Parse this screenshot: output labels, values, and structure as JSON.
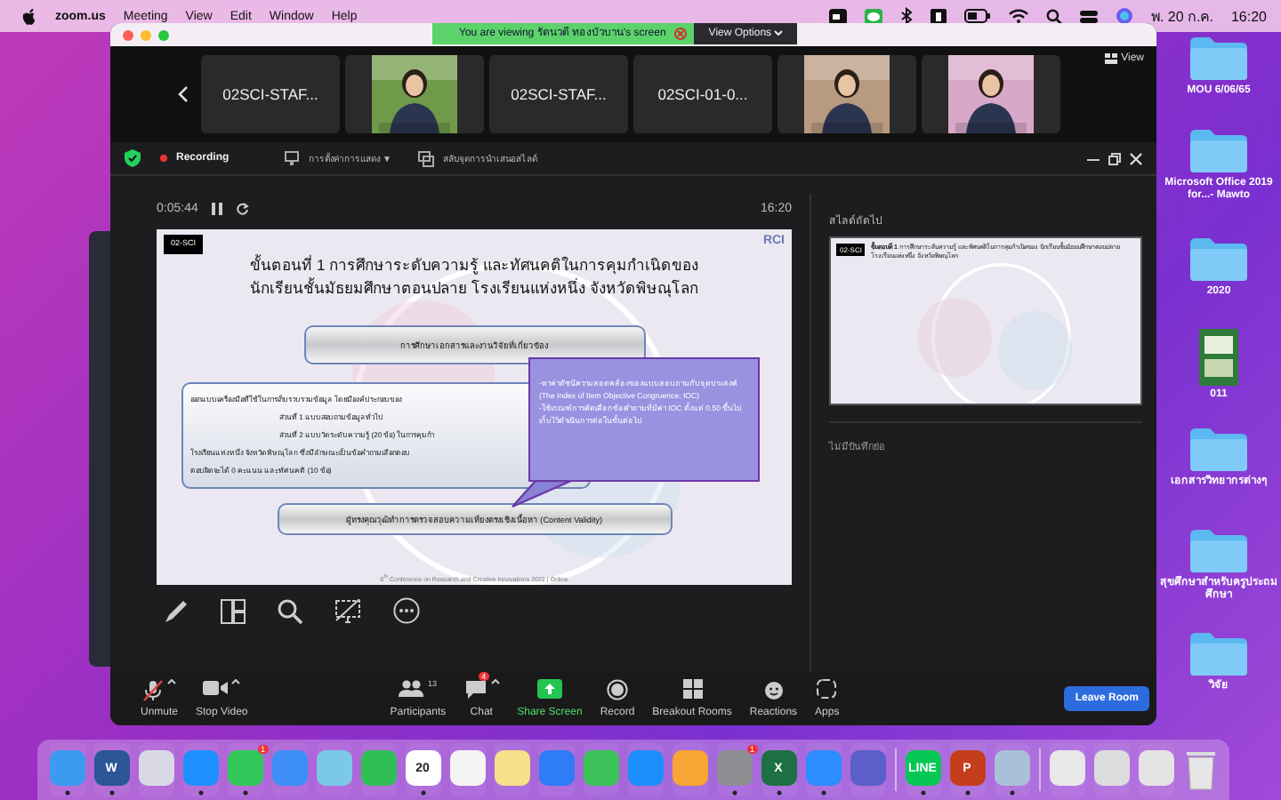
{
  "menu_bar": {
    "app": "zoom.us",
    "menus": [
      "Meeting",
      "View",
      "Edit",
      "Window",
      "Help"
    ],
    "date": "พ. 20 ก.ค.",
    "time": "16:20"
  },
  "banner": {
    "text": "You are viewing รัตนวดี ทองบัวบาน's screen",
    "options": "View Options"
  },
  "gallery": {
    "view": "View",
    "tiles": [
      {
        "kind": "name",
        "label": "02SCI-STAF..."
      },
      {
        "kind": "picture",
        "color": "#6f9a4a"
      },
      {
        "kind": "name",
        "label": "02SCI-STAF..."
      },
      {
        "kind": "name",
        "label": "02SCI-01-0..."
      },
      {
        "kind": "picture",
        "color": "#b89a80"
      },
      {
        "kind": "picture",
        "color": "#d8a8c8"
      }
    ]
  },
  "share_toolbar": {
    "recording": "Recording",
    "display_settings": "การตั้งค่าการแสดง ▼",
    "swap": "สลับจุดการนำเสนอสไลด์"
  },
  "presenter": {
    "elapsed": "0:05:44",
    "clock": "16:20",
    "slide": {
      "badge": "02-SCI",
      "logo": "RCI",
      "title": [
        "ขั้นตอนที่ 1 การศึกษาระดับความรู้ และทัศนคติในการคุมกำเนิดของ",
        "นักเรียนชั้นมัธยมศึกษาตอนปลาย โรงเรียนแห่งหนึ่ง จังหวัดพิษณุโลก"
      ],
      "box_1": "การศึกษาเอกสารและงานวิจัยที่เกี่ยวข้อง",
      "box_2": [
        "ออกแบบเครื่องมือที่ใช้ในการเก็บรวบรวมข้อมูล โดยมีองค์ประกอบของ",
        "ส่วนที่ 1 แบบสอบถามข้อมูลทั่วไป",
        "ส่วนที่ 2 แบบวัดระดับความรู้ (20 ข้อ) ในการคุมกำ",
        "โรงเรียนแห่งหนึ่ง จังหวัดพิษณุโลก ซึ่งมีลักษณะเป็นข้อคำถามเลือกตอบ",
        "ตอบผิดจะได้ 0 คะแนน และทัศนคติ (10 ข้อ)"
      ],
      "box_3": "ผู้ทรงคุณวุฒิทำการตรวจสอบความเที่ยงตรงเชิงเนื้อหา (Content Validity)",
      "callout": [
        "-หาค่าดัชนีความสอดคล้องของแบบสอบถามกับจุดประสงค์ (The Index of Item Objective Congruence; IOC)",
        "-ใช้เกณฑ์การคัดเลือกข้อคำถามที่มีค่า IOC ตั้งแต่ 0.50 ขึ้นไปเก็บไว้ดำเนินการต่อในขั้นต่อไป"
      ],
      "footer": "8$^{th}$ Conference on Research and Creative Innovations 2022 | Online"
    },
    "next_label": "สไลด์ถัดไป",
    "next_slide": {
      "badge": "02-SCI",
      "title": "**ขั้นตอนที่ 1** การศึกษาระดับความรู้ และทัศนคติในการคุมกำเนิดของ นักเรียนชั้นมัธยมศึกษาตอนปลาย โรงเรียนแห่งหนึ่ง จังหวัดพิษณุโลก"
    },
    "notes": "ไม่มีบันทึกย่อ"
  },
  "toolbar": {
    "items": [
      {
        "kind": "mic",
        "label": "Unmute",
        "caret": true
      },
      {
        "kind": "video",
        "label": "Stop Video",
        "caret": true
      },
      {
        "kind": "participants",
        "label": "Participants",
        "count": "13",
        "caret": false
      },
      {
        "kind": "chat",
        "label": "Chat",
        "badge": "4",
        "caret": true
      },
      {
        "kind": "share",
        "label": "Share Screen",
        "caret": false
      },
      {
        "kind": "record",
        "label": "Record",
        "caret": false
      },
      {
        "kind": "rooms",
        "label": "Breakout Rooms",
        "caret": false
      },
      {
        "kind": "reactions",
        "label": "Reactions",
        "caret": false
      },
      {
        "kind": "apps",
        "label": "Apps",
        "caret": false
      }
    ],
    "leave": "Leave Room"
  },
  "desktop_icons": [
    {
      "kind": "folder",
      "label": "MOU 6/06/65"
    },
    {
      "kind": "folder",
      "label": "Microsoft Office 2019 for...- Mawto"
    },
    {
      "kind": "folder",
      "label": "2020"
    },
    {
      "kind": "book",
      "label": "011"
    },
    {
      "kind": "folder",
      "label": "เอกสารวิทยากรต่างๆ"
    },
    {
      "kind": "folder",
      "label": "สุขศึกษาสำหรับครูประถมศึกษา"
    },
    {
      "kind": "folder",
      "label": "วิจัย"
    }
  ],
  "dock": [
    {
      "kind": "app",
      "color": "#3b9bf0",
      "running": true
    },
    {
      "kind": "app",
      "color": "#2b5797",
      "label": "W",
      "running": true
    },
    {
      "kind": "app",
      "color": "#d9d9e6",
      "running": false
    },
    {
      "kind": "app",
      "color": "#1e90ff",
      "running": true
    },
    {
      "kind": "app",
      "color": "#34c759",
      "badge": "1",
      "running": true
    },
    {
      "kind": "app",
      "color": "#3d8ef7",
      "running": false
    },
    {
      "kind": "app",
      "color": "#7cc8e8",
      "running": false
    },
    {
      "kind": "app",
      "color": "#2fbf55",
      "running": false
    },
    {
      "kind": "app",
      "color": "#ffffff",
      "label": "20",
      "running": true
    },
    {
      "kind": "app",
      "color": "#f4f4f4",
      "running": false
    },
    {
      "kind": "app",
      "color": "#f7e08a",
      "running": false
    },
    {
      "kind": "app",
      "color": "#2e7cf6",
      "running": false
    },
    {
      "kind": "app",
      "color": "#3cc35a",
      "running": false
    },
    {
      "kind": "app",
      "color": "#1c8ef9",
      "running": false
    },
    {
      "kind": "app",
      "color": "#f7a534",
      "running": false
    },
    {
      "kind": "app",
      "color": "#8e8e93",
      "badge": "1",
      "running": true
    },
    {
      "kind": "app",
      "color": "#1d7044",
      "label": "X",
      "running": true
    },
    {
      "kind": "app",
      "color": "#2d8cff",
      "running": true
    },
    {
      "kind": "app",
      "color": "#5b5fc7",
      "running": false
    },
    {
      "kind": "separator"
    },
    {
      "kind": "app",
      "color": "#06c755",
      "label": "LINE",
      "running": true
    },
    {
      "kind": "app",
      "color": "#c43e1c",
      "label": "P",
      "running": true
    },
    {
      "kind": "app",
      "color": "#a9c0d8",
      "running": true
    },
    {
      "kind": "separator"
    },
    {
      "kind": "app",
      "color": "#e8e8e8",
      "running": false
    },
    {
      "kind": "app",
      "color": "#dcdcdc",
      "running": false
    },
    {
      "kind": "app",
      "color": "#e4e4e4",
      "running": false
    },
    {
      "kind": "trash"
    }
  ]
}
